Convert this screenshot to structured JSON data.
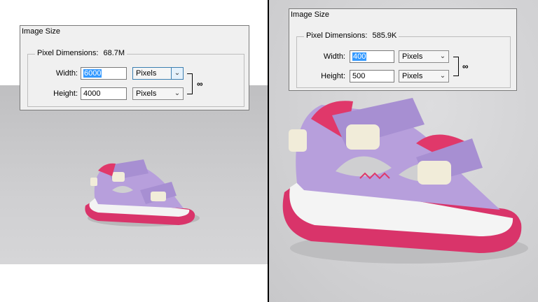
{
  "left_dialog": {
    "title": "Image Size",
    "pixel_dimensions_label": "Pixel Dimensions:",
    "pixel_dimensions_value": "68.7M",
    "width_label": "Width:",
    "width_value": "6000",
    "height_label": "Height:",
    "height_value": "4000",
    "width_unit": "Pixels",
    "height_unit": "Pixels"
  },
  "right_dialog": {
    "title": "Image Size",
    "pixel_dimensions_label": "Pixel Dimensions:",
    "pixel_dimensions_value": "585.9K",
    "width_label": "Width:",
    "width_value": "400",
    "height_label": "Height:",
    "height_value": "500",
    "width_unit": "Pixels",
    "height_unit": "Pixels"
  },
  "icons": {
    "dropdown": "chevron-down-icon",
    "constrain": "link-chain-icon"
  },
  "colors": {
    "sandal_purple": "#b79fdc",
    "sandal_pink": "#e0386a",
    "strap_cream": "#f1ecd9",
    "selection_blue": "#3399ff"
  }
}
